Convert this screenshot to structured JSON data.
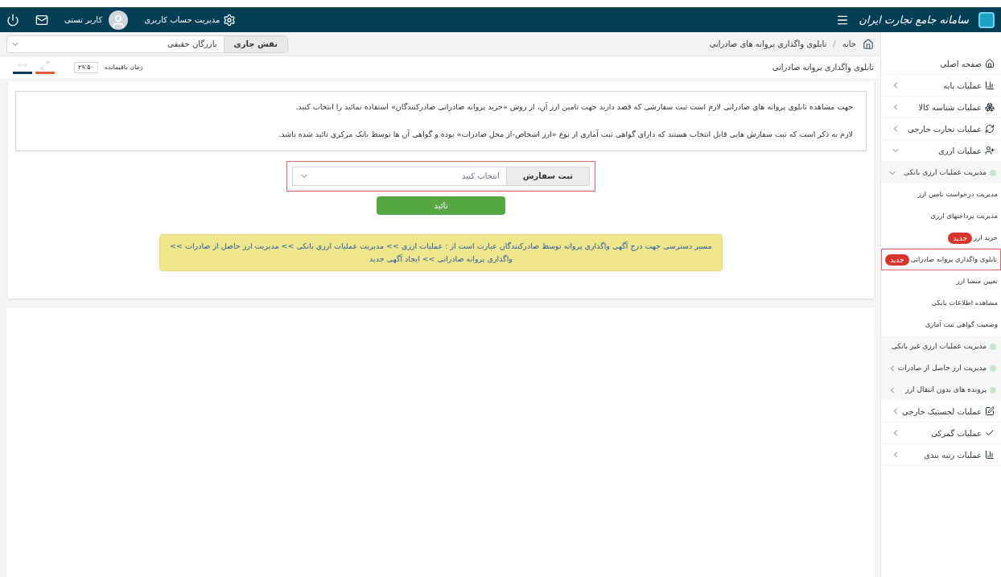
{
  "header": {
    "logo_text": "سامانه جامع تجارت ایران",
    "account_link": "مدیریت حساب کاربری",
    "user_name": "کاربر تستی"
  },
  "role_bar": {
    "label": "نقش جاری",
    "value": "بازرگان حقیقی"
  },
  "breadcrumb": [
    "خانه",
    "تابلوی واگذاری پروانه های صادراتی"
  ],
  "breadcrumb_separator": "/",
  "page_title": "تابلوی واگذاری پروانه صادراتی",
  "timer": {
    "label": "زمان باقیمانده",
    "value": "۲۹:۵۰"
  },
  "info_lines": [
    "جهت مشاهده تابلوی پروانه های صادراتی لازم است ثبت سفارشی که قصد دارید جهت تامین ارز آن، از روش «خرید پروانه صادراتی صادرکنندگان» استفاده نمائید را انتخاب کنید.",
    "لازم به ذکر است که ثبت سفارش هایی قابل انتخاب هستند که دارای گواهی ثبت آماری از نوع «ارز اشخاص-از محل صادرات» بوده و گواهی آن ها توسط بانک مرکزی تائید شده باشد."
  ],
  "order_select": {
    "label": "ثبت سفارش",
    "placeholder": "انتخاب کنید"
  },
  "confirm_button": "تائید",
  "notice": "مسیر دسترسی جهت درج آگهی واگذاری پروانه توسط صادرکنندگان عبارت است از : عملیات ارزی >> مدیریت عملیات ارزی بانکی >> مدیریت ارز حاصل از صادرات >> واگذاری پروانه صادراتی >> ایجاد آگهی جدید",
  "sidebar": {
    "items": [
      {
        "label": "صفحه اصلی",
        "has_arrow": false
      },
      {
        "label": "عملیات پایه",
        "expanded": false,
        "has_arrow": true
      },
      {
        "label": "عملیات شناسه کالا",
        "expanded": false,
        "has_arrow": true
      },
      {
        "label": "عملیات تجارت خارجی",
        "expanded": false,
        "has_arrow": true
      },
      {
        "label": "عملیات ارزی",
        "expanded": true,
        "has_arrow": true,
        "children": [
          {
            "label": "مدیریت عملیات ارزی بانکی",
            "expanded": true,
            "has_arrow": true,
            "children": [
              {
                "label": "مدیریت درخواست تامین ارز",
                "selected": false
              },
              {
                "label": "مدیریت پرداختهای ارزی",
                "selected": false
              },
              {
                "label": "خرید ارز",
                "badge": "جدید",
                "selected": false
              },
              {
                "label": "تابلوی واگذاری پروانه صادراتی",
                "badge": "جدید",
                "selected": true
              },
              {
                "label": "تعیین منشا ارز",
                "selected": false
              },
              {
                "label": "مشاهده اطلاعات بانکی",
                "selected": false
              },
              {
                "label": "وضعیت گواهی ثبت آماری",
                "selected": false
              }
            ]
          },
          {
            "label": "مدیریت عملیات ارزی غیر بانکی",
            "has_arrow": false
          },
          {
            "label": "مدیریت ارز حاصل از صادرات",
            "expanded": false,
            "has_arrow": true
          },
          {
            "label": "پرونده های بدون انتقال ارز",
            "expanded": false,
            "has_arrow": true
          }
        ]
      },
      {
        "label": "عملیات لجستیک خارجی",
        "expanded": false,
        "has_arrow": true
      },
      {
        "label": "عملیات گمرکی",
        "expanded": false,
        "has_arrow": true
      },
      {
        "label": "عملیات رتبه بندی",
        "expanded": false,
        "has_arrow": true
      }
    ]
  }
}
